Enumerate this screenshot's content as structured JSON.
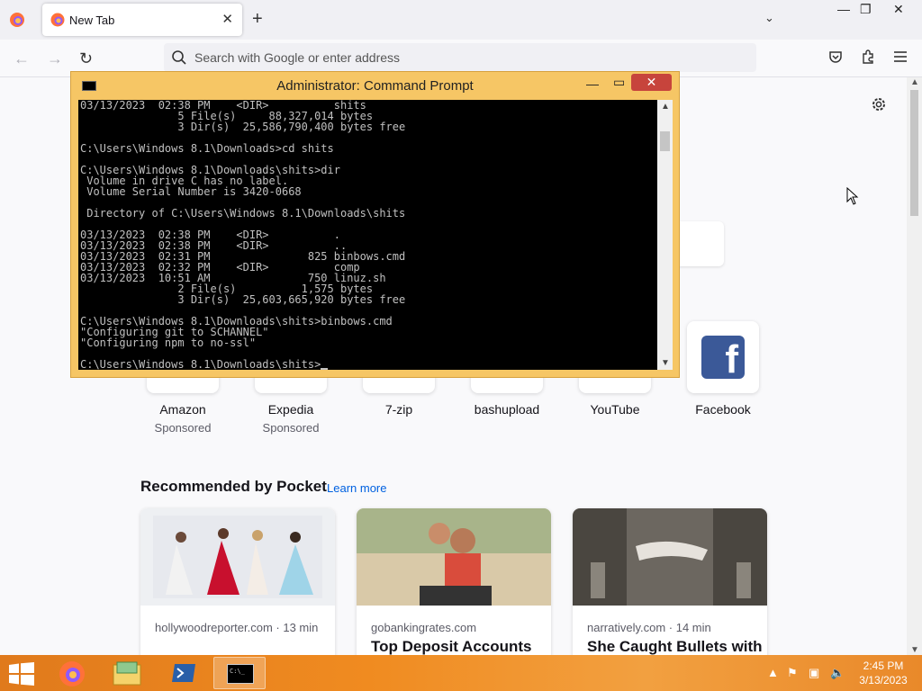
{
  "browser": {
    "tab_title": "New Tab",
    "url_placeholder": "Search with Google or enter address"
  },
  "cmd": {
    "title": "Administrator: Command Prompt",
    "lines": [
      "03/13/2023  02:38 PM    <DIR>          shits",
      "               5 File(s)     88,327,014 bytes",
      "               3 Dir(s)  25,586,790,400 bytes free",
      "",
      "C:\\Users\\Windows 8.1\\Downloads>cd shits",
      "",
      "C:\\Users\\Windows 8.1\\Downloads\\shits>dir",
      " Volume in drive C has no label.",
      " Volume Serial Number is 3420-0668",
      "",
      " Directory of C:\\Users\\Windows 8.1\\Downloads\\shits",
      "",
      "03/13/2023  02:38 PM    <DIR>          .",
      "03/13/2023  02:38 PM    <DIR>          ..",
      "03/13/2023  02:31 PM               825 binbows.cmd",
      "03/13/2023  02:32 PM    <DIR>          comp",
      "03/13/2023  10:51 AM               750 linuz.sh",
      "               2 File(s)          1,575 bytes",
      "               3 Dir(s)  25,603,665,920 bytes free",
      "",
      "C:\\Users\\Windows 8.1\\Downloads\\shits>binbows.cmd",
      "\"Configuring git to SCHANNEL\"",
      "\"Configuring npm to no-ssl\"",
      "",
      "C:\\Users\\Windows 8.1\\Downloads\\shits>"
    ]
  },
  "shortcuts": [
    {
      "label": "Amazon",
      "sub": "Sponsored"
    },
    {
      "label": "Expedia",
      "sub": "Sponsored"
    },
    {
      "label": "7-zip",
      "sub": ""
    },
    {
      "label": "bashupload",
      "sub": ""
    },
    {
      "label": "YouTube",
      "sub": ""
    },
    {
      "label": "Facebook",
      "sub": ""
    }
  ],
  "pocket": {
    "title": "Recommended by Pocket",
    "learn_more": "Learn more",
    "cards": [
      {
        "source": "hollywoodreporter.com · 13 min",
        "title": ""
      },
      {
        "source": "gobankingrates.com",
        "title": "Top Deposit Accounts"
      },
      {
        "source": "narratively.com · 14 min",
        "title": "She Caught Bullets with"
      }
    ]
  },
  "taskbar": {
    "time": "2:45 PM",
    "date": "3/13/2023"
  },
  "colors": {
    "taskbar": "#f08b20",
    "cmd_frame": "#f6c665",
    "accent_link": "#0061e0",
    "facebook": "#3b5998"
  }
}
